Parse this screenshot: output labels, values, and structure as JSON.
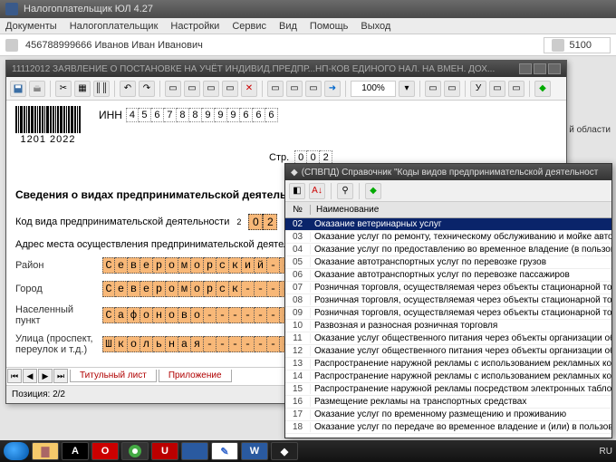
{
  "main_title": "Налогоплательщик ЮЛ 4.27",
  "menu": [
    "Документы",
    "Налогоплательщик",
    "Настройки",
    "Сервис",
    "Вид",
    "Помощь",
    "Выход"
  ],
  "user_info": "456788999666 Иванов Иван Иванович",
  "code_field": "5100",
  "side_text": "й области",
  "doc": {
    "title": "11112012 ЗАЯВЛЕНИЕ О ПОСТАНОВКЕ НА УЧЁТ ИНДИВИД.ПРЕДПР...НП-КОВ ЕДИНОГО НАЛ. НА ВМЕН. ДОХ...",
    "zoom": "100%",
    "barcode_num": "1201 2022",
    "inn_label": "ИНН",
    "inn_cells": [
      "4",
      "5",
      "6",
      "7",
      "8",
      "8",
      "9",
      "9",
      "9",
      "6",
      "6",
      "6"
    ],
    "page_label": "Стр.",
    "page_cells": [
      "0",
      "0",
      "2"
    ],
    "section_title": "Сведения о видах предпринимательской деятельности и ме",
    "activity_code_label": "Код вида предпринимательской деятельности",
    "activity_sup": "2",
    "activity_code": [
      "0",
      "2"
    ],
    "addr_label": "Адрес места осуществления предпринимательской деятельности:",
    "fields": [
      {
        "label": "Район",
        "value": "Североморский--"
      },
      {
        "label": "Город",
        "value": "Североморск-----"
      },
      {
        "label": "Населенный пункт",
        "value": "Сафоново--------"
      },
      {
        "label": "Улица (проспект, переулок и т.д.)",
        "value": "Школьная--------"
      }
    ],
    "tabs": [
      "Титульный лист",
      "Приложение"
    ],
    "position": "Позиция: 2/2"
  },
  "ref": {
    "title": "(СПВПД) Справочник \"Коды видов предпринимательской деятельност",
    "col_num": "№",
    "col_name": "Наименование",
    "rows": [
      {
        "n": "02",
        "t": "Оказание ветеринарных услуг",
        "sel": true
      },
      {
        "n": "03",
        "t": "Оказание услуг по ремонту, техническому обслуживанию и мойке автотранс"
      },
      {
        "n": "04",
        "t": "Оказание услуг по предоставлению во временное владение (в пользование)"
      },
      {
        "n": "05",
        "t": "Оказание автотранспортных услуг по перевозке грузов"
      },
      {
        "n": "06",
        "t": "Оказание автотранспортных услуг по перевозке пассажиров"
      },
      {
        "n": "07",
        "t": "Розничная торговля, осуществляемая через объекты стационарной торговой"
      },
      {
        "n": "08",
        "t": "Розничная торговля, осуществляемая через объекты стационарной торговой"
      },
      {
        "n": "09",
        "t": "Розничная торговля, осуществляемая через объекты стационарной торговой"
      },
      {
        "n": "10",
        "t": "Развозная и разносная розничная торговля"
      },
      {
        "n": "11",
        "t": "Оказание услуг общественного питания через объекты организации общест"
      },
      {
        "n": "12",
        "t": "Оказание услуг общественного питания через объекты организации общест"
      },
      {
        "n": "13",
        "t": "Распространение наружной рекламы с использованием рекламных конструк"
      },
      {
        "n": "14",
        "t": "Распространение наружной рекламы с использованием рекламных конструк"
      },
      {
        "n": "15",
        "t": "Распространение наружной рекламы посредством электронных табло"
      },
      {
        "n": "16",
        "t": "Размещение рекламы на транспортных средствах"
      },
      {
        "n": "17",
        "t": "Оказание услуг по временному размещению и проживанию"
      },
      {
        "n": "18",
        "t": "Оказание услуг по передаче во временное владение и (или) в пользование т"
      }
    ]
  },
  "taskbar_lang": "RU"
}
